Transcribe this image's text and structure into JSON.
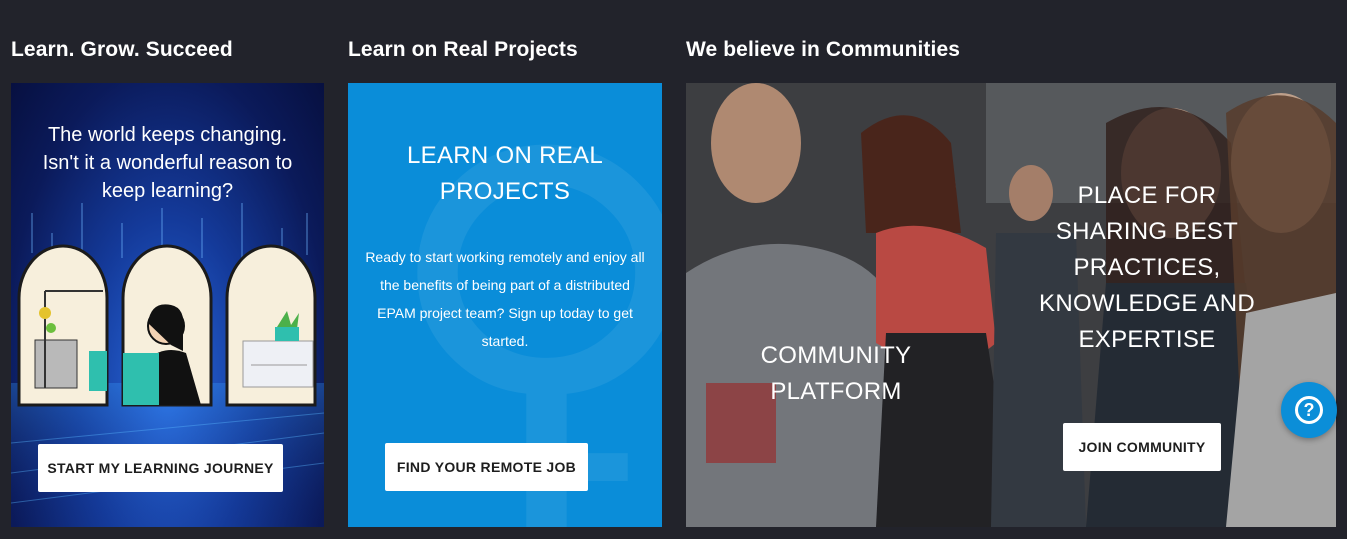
{
  "columns": [
    {
      "title": "Learn. Grow. Succeed"
    },
    {
      "title": "Learn on Real Projects"
    },
    {
      "title": "We believe in Communities"
    }
  ],
  "card1": {
    "headline": "The world keeps changing. Isn't it a wonderful reason to keep learning?",
    "button": "START MY LEARNING JOURNEY"
  },
  "card2": {
    "headline": "LEARN ON REAL PROJECTS",
    "body": "Ready to start working remotely and enjoy all the benefits of being part of a distributed EPAM project team? Sign up today to get started.",
    "button": "FIND YOUR REMOTE JOB"
  },
  "card3": {
    "left_label": "COMMUNITY PLATFORM",
    "right_label": "PLACE FOR SHARING BEST PRACTICES, KNOWLEDGE AND EXPERTISE",
    "button": "JOIN COMMUNITY"
  },
  "help": {
    "icon": "question-icon",
    "glyph": "?"
  },
  "colors": {
    "background": "#22232b",
    "accent": "#0a8dd9"
  }
}
